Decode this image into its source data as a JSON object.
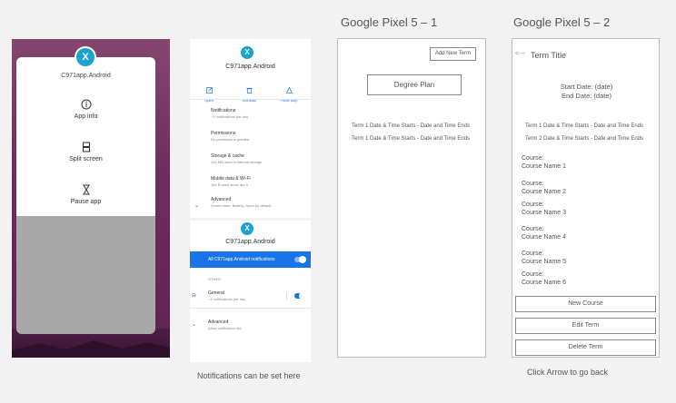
{
  "panel1": {
    "app_name": "C971app.Android",
    "logo_letter": "X",
    "menu": [
      {
        "label": "App info",
        "icon": "info-icon"
      },
      {
        "label": "Split screen",
        "icon": "split-screen-icon"
      },
      {
        "label": "Pause app",
        "icon": "hourglass-icon"
      }
    ]
  },
  "panel2": {
    "app_name": "C971app.Android",
    "app_name_2": "C971app.Android",
    "logo_letter": "X",
    "actions": [
      {
        "label": "Open",
        "icon": "open-icon"
      },
      {
        "label": "Uninstall",
        "icon": "trash-icon"
      },
      {
        "label": "Force stop",
        "icon": "warning-icon"
      }
    ],
    "settings": [
      {
        "title": "Notifications",
        "sub": "~4 notifications per day"
      },
      {
        "title": "Permissions",
        "sub": "No permissions granted"
      },
      {
        "title": "Storage & cache",
        "sub": "132 MB used in internal storage"
      },
      {
        "title": "Mobile data & Wi-Fi",
        "sub": "160 B used since Apr 5"
      }
    ],
    "advanced": {
      "title": "Advanced",
      "sub": "Screen time, Battery, Open by default"
    },
    "all_notifications": "All C971app.Android notifications",
    "section_other": "OTHER",
    "general": {
      "title": "General",
      "sub": "~4 notifications per day"
    },
    "advanced2": {
      "title": "Advanced",
      "sub": "Allow notification dot"
    },
    "colors": {
      "accent": "#1a73e8"
    }
  },
  "caption_notifications": "Notifications can be set here",
  "screen1": {
    "title": "Google Pixel 5 – 1",
    "add_button": "Add New Term",
    "plan_button": "Degree Plan",
    "terms": [
      "Term 1 Date & Time Starts  - Date and Time Ends",
      "Term 1 Date & Time Starts  - Date and Time Ends"
    ]
  },
  "screen2": {
    "title": "Google Pixel 5 – 2",
    "back_arrow": "<---",
    "term_title": "Term Title",
    "start_date": "Start Date: (date)",
    "end_date": "End Date: (date)",
    "terms": [
      "Term 1 Date & Time Starts  - Date and Time Ends",
      "Term 2 Date & Time Starts  - Date and Time Ends"
    ],
    "courses": [
      {
        "label": "Course:",
        "name": "Course Name 1"
      },
      {
        "label": "Course:",
        "name": "Course Name 2"
      },
      {
        "label": "Course:",
        "name": "Course Name 3"
      },
      {
        "label": "Course:",
        "name": "Course Name 4"
      },
      {
        "label": "Course:",
        "name": "Course Name 5"
      },
      {
        "label": "Course:",
        "name": "Course Name 6"
      }
    ],
    "buttons": [
      "New Course",
      "Edit Term",
      "Delete Term"
    ]
  },
  "caption_back": "Click Arrow to go back"
}
